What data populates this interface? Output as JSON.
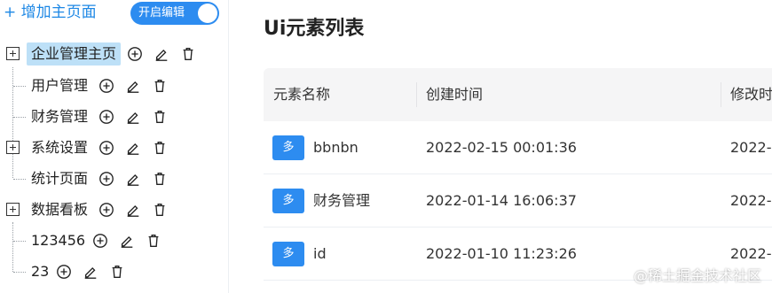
{
  "sidebar": {
    "add_main_page": "+ 增加主页面",
    "edit_toggle_label": "开启编辑",
    "edit_toggle_on": true,
    "nodes": [
      {
        "label": "企业管理主页",
        "expandable": true,
        "selected": true
      },
      {
        "label": "用户管理",
        "expandable": false,
        "selected": false
      },
      {
        "label": "财务管理",
        "expandable": false,
        "selected": false
      },
      {
        "label": "系统设置",
        "expandable": true,
        "selected": false
      },
      {
        "label": "统计页面",
        "expandable": false,
        "selected": false
      },
      {
        "label": "数据看板",
        "expandable": true,
        "selected": false
      },
      {
        "label": "123456",
        "expandable": false,
        "selected": false
      },
      {
        "label": "23",
        "expandable": false,
        "selected": false
      }
    ],
    "node_action_icons": [
      "add-circle-icon",
      "edit-pencil-icon",
      "trash-icon"
    ]
  },
  "main": {
    "title": "Ui元素列表",
    "table": {
      "headers": [
        "元素名称",
        "创建时间",
        "修改时"
      ],
      "rows": [
        {
          "badge": "多",
          "name": "bbnbn",
          "created": "2022-02-15 00:01:36",
          "modified": "2022-0"
        },
        {
          "badge": "多",
          "name": "财务管理",
          "created": "2022-01-14 16:06:37",
          "modified": "2022-0"
        },
        {
          "badge": "多",
          "name": "id",
          "created": "2022-01-10 11:23:26",
          "modified": "2022-0"
        }
      ]
    }
  },
  "watermark": "@稀土掘金技术社区",
  "colors": {
    "accent": "#2d8cf0",
    "link": "#1e88e5",
    "selected_bg": "#bde0f7",
    "header_bg": "#f5f5f6"
  }
}
